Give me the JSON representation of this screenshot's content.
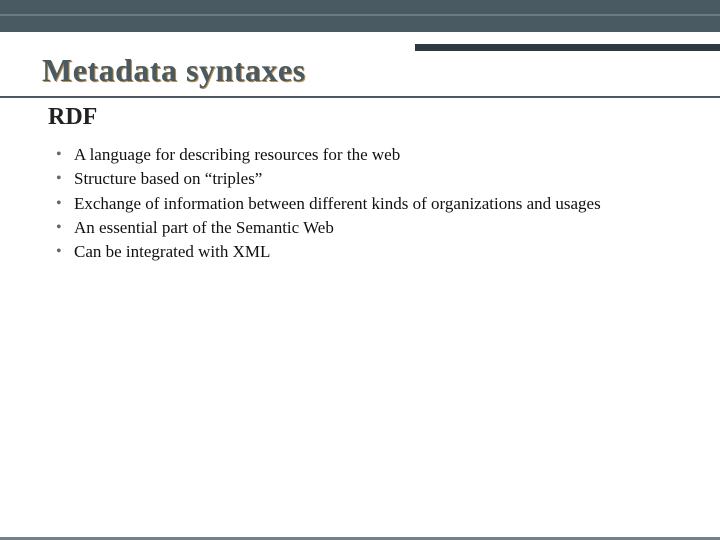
{
  "slide": {
    "title": "Metadata syntaxes",
    "subtitle": "RDF",
    "bullets": [
      "A language for describing resources for the web",
      "Structure based on “triples”",
      "Exchange of information between different kinds of organizations and usages",
      "An essential part of the Semantic Web",
      "Can be integrated with XML"
    ]
  }
}
